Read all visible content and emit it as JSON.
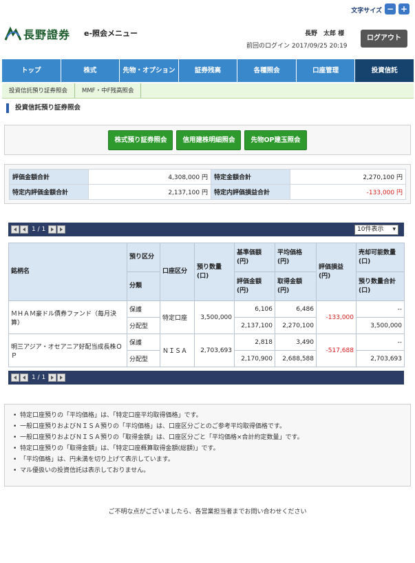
{
  "header": {
    "font_size_label": "文字サイズ",
    "font_minus": "−",
    "font_plus": "+",
    "brand": "長野證券",
    "menu_title": "e-照会メニュー",
    "user_name": "長野　太郎 様",
    "last_login": "前回のログイン 2017/09/25 20:19",
    "logout_label": "ログアウト"
  },
  "nav": {
    "items": [
      "トップ",
      "株式",
      "先物・オプション",
      "証券残高",
      "各種照会",
      "口座管理",
      "投資信託"
    ],
    "active_index": 6
  },
  "subnav": {
    "items": [
      "投資信託預り証券照会",
      "MMF・中F残高照会"
    ]
  },
  "page_title": "投資信託預り証券照会",
  "buttons": [
    "株式預り証券照会",
    "信用建株明細照会",
    "先物OP建玉照会"
  ],
  "summary": {
    "rows": [
      {
        "l1": "評価金額合計",
        "v1": "4,308,000 円",
        "l2": "特定金額合計",
        "v2": "2,270,100 円"
      },
      {
        "l1": "特定内評価金額合計",
        "v1": "2,137,100 円",
        "l2": "特定内評価損益合計",
        "v2": "-133,000 円"
      }
    ]
  },
  "pager": {
    "text": "1 / 1",
    "per_page": "10件表示"
  },
  "table": {
    "headers": {
      "name": "銘柄名",
      "deposit_type": "預り区分",
      "category": "分類",
      "account_type": "口座区分",
      "quantity": "預り数量\n(口)",
      "base_price": "基準価額\n(円)",
      "eval_amount": "評価金額\n(円)",
      "avg_price": "平均価格\n(円)",
      "acq_amount": "取得金額\n(円)",
      "pnl": "評価損益\n(円)",
      "sellable": "売却可能数量\n(口)",
      "total_qty": "預り数量合計\n(口)"
    },
    "rows": [
      {
        "name": "ＭＨＡＭ豪ドル債券ファンド（毎月決算）",
        "deposit": "保護",
        "category": "分配型",
        "account": "特定口座",
        "qty": "3,500,000",
        "base": "6,106",
        "eval": "2,137,100",
        "avg": "6,486",
        "acq": "2,270,100",
        "pnl": "-133,000",
        "sellable": "--",
        "total": "3,500,000"
      },
      {
        "name": "明三アジア・オセアニア好配当成長株ＯＰ",
        "deposit": "保護",
        "category": "分配型",
        "account": "ＮＩＳＡ",
        "qty": "2,703,693",
        "base": "2,818",
        "eval": "2,170,900",
        "avg": "3,490",
        "acq": "2,688,588",
        "pnl": "-517,688",
        "sellable": "--",
        "total": "2,703,693"
      }
    ]
  },
  "notes": [
    "特定口座預りの「平均価格」は、「特定口座平均取得価格」です。",
    "一般口座預りおよびＮＩＳＡ預りの「平均価格」は、口座区分ごとのご参考平均取得価格です。",
    "一般口座預りおよびＮＩＳＡ預りの「取得金額」は、口座区分ごと「平均価格×合計約定数量」です。",
    "特定口座預りの「取得金額」は、「特定口座概算取得金額(総額)」です。",
    "「平均価格」は、円未満を切り上げて表示しています。",
    "マル優扱いの投資信託は表示しておりません。"
  ],
  "footer": "ご不明な点がございましたら、各営業担当者までお問い合わせください"
}
